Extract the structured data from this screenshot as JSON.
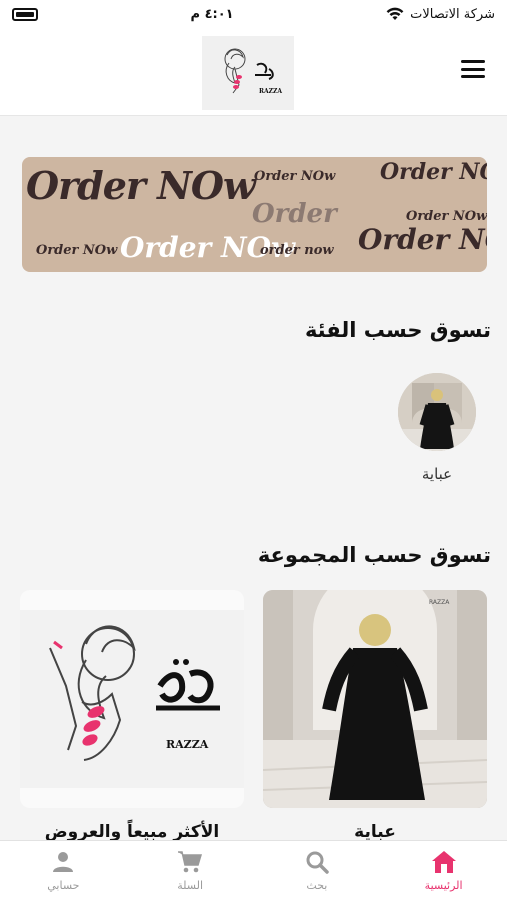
{
  "status_bar": {
    "carrier": "شركة الاتصالات",
    "time": "٤:٠١ م"
  },
  "header": {
    "logo_alt": "RAZZA"
  },
  "banner": {
    "texts": [
      "Order NOw",
      "Order NOw",
      "Order NOw",
      "Order",
      "Order NOw",
      "Order NOw",
      "Order NOw",
      "Order NOw",
      "order now"
    ]
  },
  "categories_section": {
    "title": "تسوق حسب الفئة",
    "items": [
      {
        "label": "عباية"
      }
    ]
  },
  "collections_section": {
    "title": "تسوق حسب المجموعة",
    "items": [
      {
        "label": "عباية"
      },
      {
        "label": "الأكثر مبيعاً والعروض"
      }
    ]
  },
  "bottom_nav": {
    "items": [
      {
        "label": "الرئيسية",
        "icon": "home-icon",
        "active": true
      },
      {
        "label": "بحث",
        "icon": "search-icon",
        "active": false
      },
      {
        "label": "السلة",
        "icon": "cart-icon",
        "active": false
      },
      {
        "label": "حسابي",
        "icon": "account-icon",
        "active": false
      }
    ]
  },
  "colors": {
    "accent": "#e8336e",
    "banner_bg": "#cdb6a1"
  }
}
